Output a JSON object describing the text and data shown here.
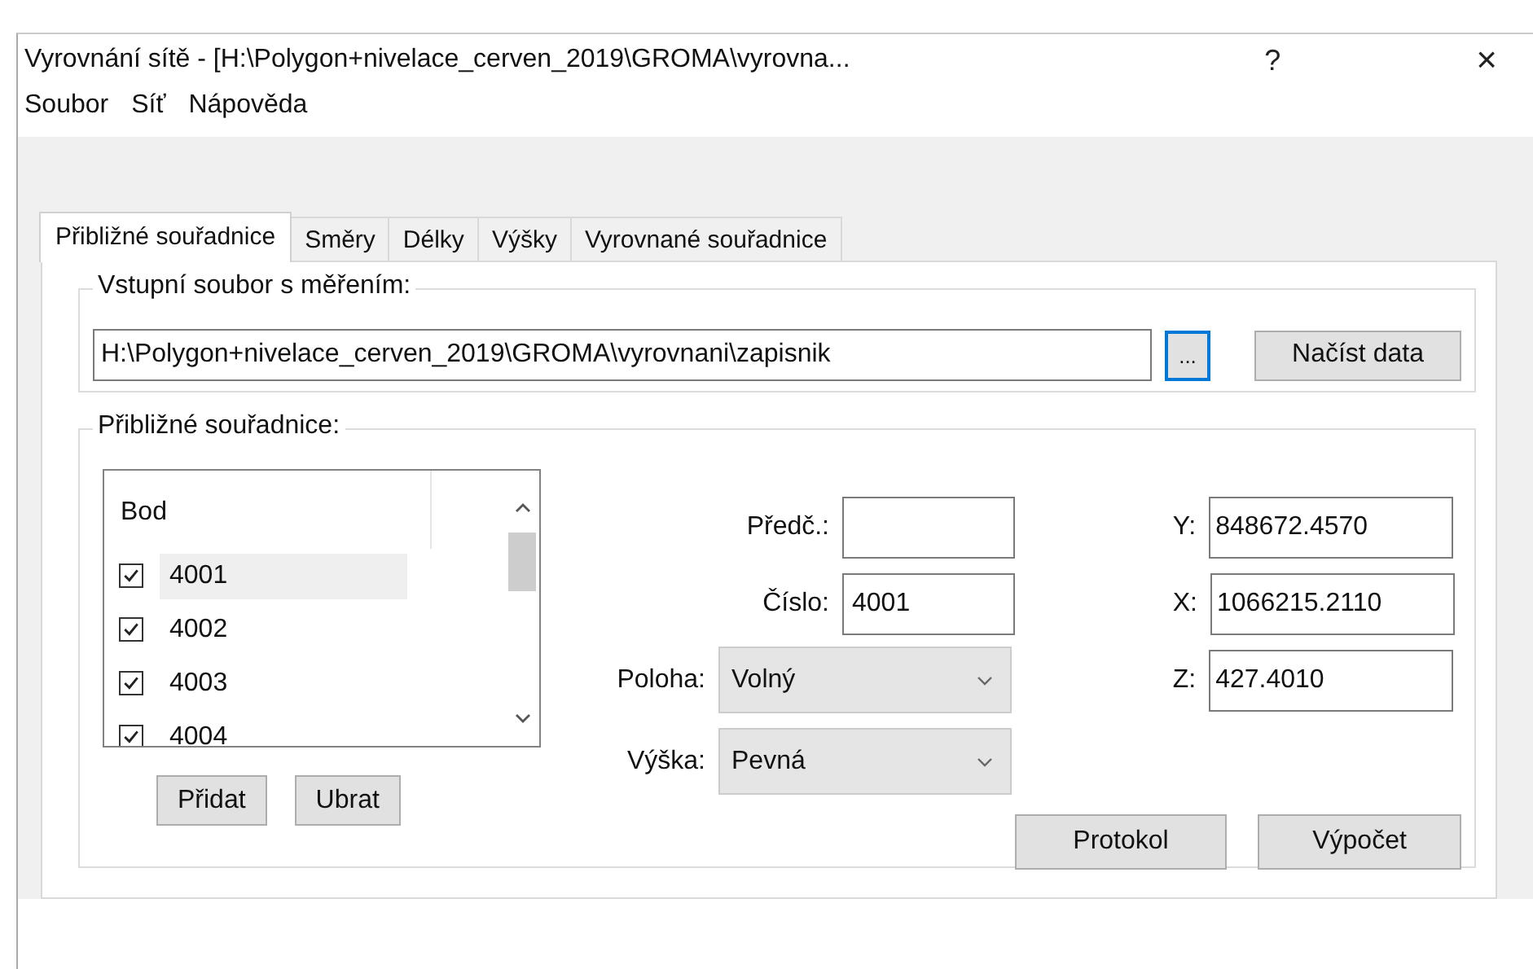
{
  "window": {
    "title": "Vyrovnání sítě - [H:\\Polygon+nivelace_cerven_2019\\GROMA\\vyrovna...",
    "help": "?",
    "close": "×"
  },
  "menu": [
    "Soubor",
    "Síť",
    "Nápověda"
  ],
  "tabs": [
    {
      "label": "Přibližné souřadnice",
      "selected": true
    },
    {
      "label": "Směry",
      "selected": false
    },
    {
      "label": "Délky",
      "selected": false
    },
    {
      "label": "Výšky",
      "selected": false
    },
    {
      "label": "Vyrovnané souřadnice",
      "selected": false
    }
  ],
  "input_group": {
    "legend": "Vstupní soubor s měřením:",
    "path": "H:\\Polygon+nivelace_cerven_2019\\GROMA\\vyrovnani\\zapisnik",
    "browse": "...",
    "load": "Načíst data"
  },
  "points_group": {
    "legend": "Přibližné souřadnice:",
    "list": {
      "header": "Bod",
      "rows": [
        {
          "label": "4001",
          "checked": true,
          "selected": true
        },
        {
          "label": "4002",
          "checked": true,
          "selected": false
        },
        {
          "label": "4003",
          "checked": true,
          "selected": false
        },
        {
          "label": "4004",
          "checked": true,
          "selected": false
        }
      ]
    },
    "list_buttons": [
      "Přidat",
      "Ubrat"
    ],
    "fields": [
      {
        "label": "Předč.:"
      },
      {
        "label": "Číslo:",
        "value": "4001"
      }
    ],
    "combos": [
      {
        "label": "Poloha:",
        "value": "Volný"
      },
      {
        "label": "Výška:",
        "value": "Pevná"
      }
    ],
    "coords": [
      {
        "label": "Y:",
        "value": "848672.4570"
      },
      {
        "label": "X:",
        "value": "1066215.2110"
      },
      {
        "label": "Z:",
        "value": "427.4010"
      }
    ],
    "actions": [
      "Protokol",
      "Výpočet"
    ]
  }
}
